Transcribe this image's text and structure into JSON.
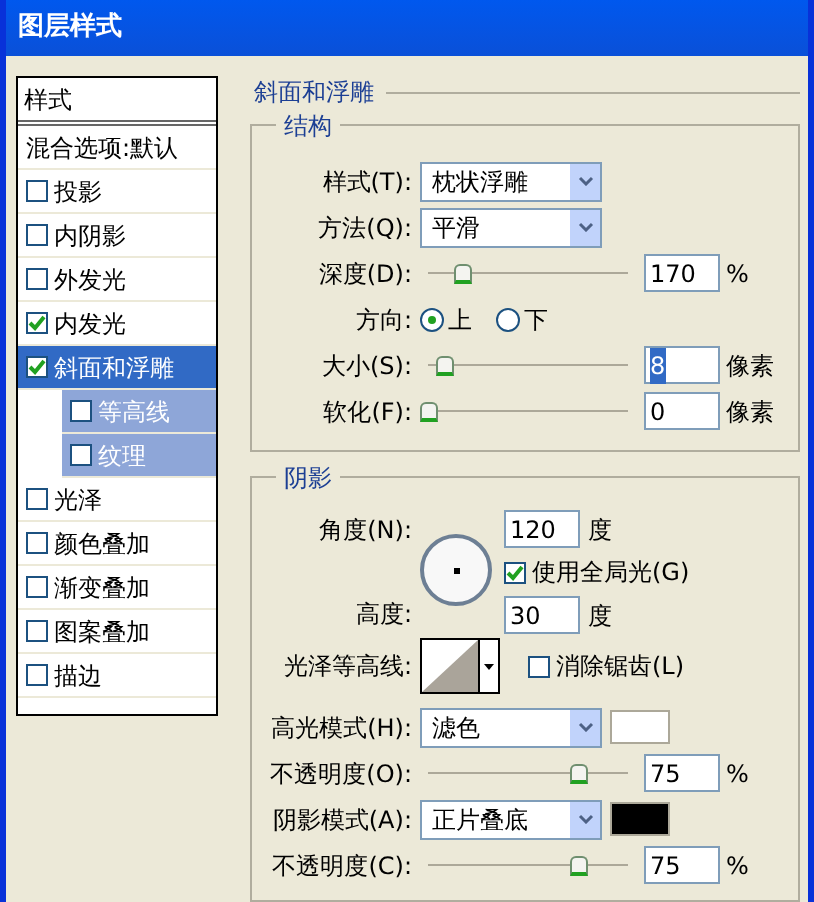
{
  "window": {
    "title": "图层样式"
  },
  "sidebar": {
    "header": "样式",
    "items": [
      {
        "label": "混合选项:默认",
        "kind": "plain",
        "selected": false
      },
      {
        "label": "投影",
        "kind": "check",
        "checked": false,
        "selected": false
      },
      {
        "label": "内阴影",
        "kind": "check",
        "checked": false,
        "selected": false
      },
      {
        "label": "外发光",
        "kind": "check",
        "checked": false,
        "selected": false
      },
      {
        "label": "内发光",
        "kind": "check",
        "checked": true,
        "selected": false
      },
      {
        "label": "斜面和浮雕",
        "kind": "check",
        "checked": true,
        "selected": true,
        "children": [
          {
            "label": "等高线",
            "kind": "check",
            "checked": false,
            "selected": false
          },
          {
            "label": "纹理",
            "kind": "check",
            "checked": false,
            "selected": false
          }
        ]
      },
      {
        "label": "光泽",
        "kind": "check",
        "checked": false,
        "selected": false
      },
      {
        "label": "颜色叠加",
        "kind": "check",
        "checked": false,
        "selected": false
      },
      {
        "label": "渐变叠加",
        "kind": "check",
        "checked": false,
        "selected": false
      },
      {
        "label": "图案叠加",
        "kind": "check",
        "checked": false,
        "selected": false
      },
      {
        "label": "描边",
        "kind": "check",
        "checked": false,
        "selected": false
      }
    ]
  },
  "panel": {
    "title": "斜面和浮雕",
    "structure": {
      "title": "结构",
      "rows": [
        {
          "kind": "select",
          "label": "样式(T):",
          "value": "枕状浮雕"
        },
        {
          "kind": "select",
          "label": "方法(Q):",
          "value": "平滑"
        },
        {
          "kind": "slider",
          "label": "深度(D):",
          "level": 0.17,
          "value": "170",
          "unit": "%"
        },
        {
          "kind": "radio",
          "label": "方向:",
          "options": [
            {
              "label": "上",
              "selected": true
            },
            {
              "label": "下",
              "selected": false
            }
          ]
        },
        {
          "kind": "slider",
          "label": "大小(S):",
          "level": 0.08,
          "value": "8",
          "unit": "像素",
          "highlighted": true
        },
        {
          "kind": "slider",
          "label": "软化(F):",
          "level": 0,
          "value": "0",
          "unit": "像素"
        }
      ]
    },
    "shading": {
      "title": "阴影",
      "angle": {
        "label": "角度(N):",
        "value": "120",
        "unit": "度"
      },
      "global_light": {
        "label": "使用全局光(G)",
        "checked": true
      },
      "altitude": {
        "label": "高度:",
        "value": "30",
        "unit": "度"
      },
      "gloss_contour": {
        "label": "光泽等高线:"
      },
      "anti_alias": {
        "label": "消除锯齿(L)",
        "checked": false
      },
      "rows": [
        {
          "kind": "select",
          "label": "高光模式(H):",
          "value": "滤色",
          "color": "#ffffff"
        },
        {
          "kind": "slider",
          "label": "不透明度(O):",
          "level": 0.75,
          "value": "75",
          "unit": "%"
        },
        {
          "kind": "select",
          "label": "阴影模式(A):",
          "value": "正片叠底",
          "color": "#000000"
        },
        {
          "kind": "slider",
          "label": "不透明度(C):",
          "level": 0.75,
          "value": "75",
          "unit": "%"
        }
      ]
    }
  }
}
